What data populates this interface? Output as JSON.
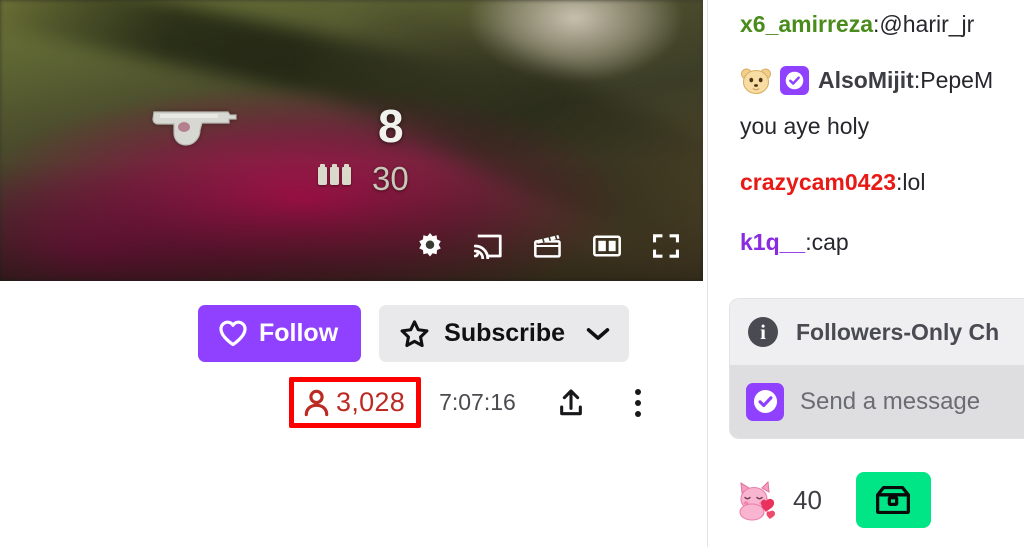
{
  "player": {
    "hud": {
      "weapon_icon": "pistol-icon",
      "ammo_in_mag": "8",
      "ammo_reserve": "30",
      "magazine_pips": 3
    },
    "controls": [
      {
        "name": "settings-icon",
        "label": "Settings"
      },
      {
        "name": "cast-icon",
        "label": "Cast"
      },
      {
        "name": "clip-icon",
        "label": "Clip"
      },
      {
        "name": "theater-mode-icon",
        "label": "Theatre Mode"
      },
      {
        "name": "fullscreen-icon",
        "label": "Fullscreen"
      }
    ]
  },
  "channel_bar": {
    "follow_label": "Follow",
    "subscribe_label": "Subscribe",
    "viewer_count": "3,028",
    "uptime": "7:07:16",
    "share_icon": "share-icon",
    "more_icon": "kebab-menu-icon",
    "highlight_color": "#ff0000",
    "viewer_count_color": "#bb2b23",
    "follow_button_color": "#8f41ff",
    "subscribe_button_color": "#e9e9eb"
  },
  "chat": {
    "messages": [
      {
        "username": "x6_amirreza",
        "color": "#4a8c1c",
        "separator": ": ",
        "text": "@harir_jr",
        "badges": []
      },
      {
        "username": "AlsoMijit",
        "color": "#3d3d44",
        "separator": ": ",
        "text": "PepeM",
        "text_line2": "you aye holy",
        "badges": [
          "bear-emote",
          "verified-badge"
        ]
      },
      {
        "username": "crazycam0423",
        "color": "#e91916",
        "separator": ": ",
        "text": "lol",
        "badges": []
      },
      {
        "username": "k1q__",
        "color": "#8a2be2",
        "separator": ": ",
        "text": "cap",
        "badges": []
      }
    ],
    "followers_only_banner": {
      "icon": "info-icon",
      "text": "Followers-Only Ch"
    },
    "input": {
      "badge_icon": "verified-badge-icon",
      "placeholder": "Send a message"
    },
    "bottom_bar": {
      "emote_icon": "pink-cat-emote",
      "bits_count": "40",
      "chest_button_icon": "chest-icon",
      "chest_button_color": "#00e585"
    }
  }
}
